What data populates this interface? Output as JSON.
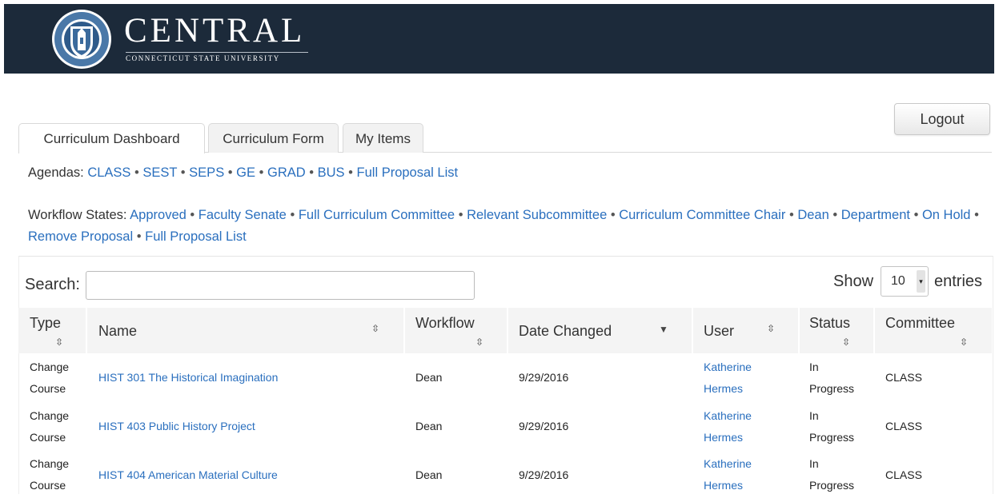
{
  "header": {
    "logo_word": "CENTRAL",
    "logo_subtitle": "CONNECTICUT STATE UNIVERSITY"
  },
  "logout_label": "Logout",
  "tabs": [
    {
      "label": "Curriculum Dashboard",
      "active": true
    },
    {
      "label": "Curriculum Form",
      "active": false
    },
    {
      "label": "My Items",
      "active": false
    }
  ],
  "agendas": {
    "prefix": "Agendas:",
    "links": [
      "CLASS",
      "SEST",
      "SEPS",
      "GE",
      "GRAD",
      "BUS",
      "Full Proposal List"
    ]
  },
  "workflow_states": {
    "prefix": "Workflow States:",
    "links": [
      "Approved",
      "Faculty Senate",
      "Full Curriculum Committee",
      "Relevant Subcommittee",
      "Curriculum Committee Chair",
      "Dean",
      "Department",
      "On Hold",
      "Remove Proposal",
      "Full Proposal List"
    ]
  },
  "search": {
    "label": "Search:",
    "value": ""
  },
  "length": {
    "show_label": "Show",
    "value": "10",
    "entries_label": "entries"
  },
  "table": {
    "columns": [
      "Type",
      "Name",
      "Workflow",
      "Date Changed",
      "User",
      "Status",
      "Committee"
    ],
    "rows": [
      {
        "type": [
          "Change",
          "Course"
        ],
        "name": "HIST 301 The Historical Imagination",
        "workflow": "Dean",
        "date": "9/29/2016",
        "user": [
          "Katherine",
          "Hermes"
        ],
        "status": [
          "In",
          "Progress"
        ],
        "committee": "CLASS"
      },
      {
        "type": [
          "Change",
          "Course"
        ],
        "name": "HIST 403 Public History Project",
        "workflow": "Dean",
        "date": "9/29/2016",
        "user": [
          "Katherine",
          "Hermes"
        ],
        "status": [
          "In",
          "Progress"
        ],
        "committee": "CLASS"
      },
      {
        "type": [
          "Change",
          "Course"
        ],
        "name": "HIST 404 American Material Culture",
        "workflow": "Dean",
        "date": "9/29/2016",
        "user": [
          "Katherine",
          "Hermes"
        ],
        "status": [
          "In",
          "Progress"
        ],
        "committee": "CLASS"
      }
    ]
  },
  "colors": {
    "header_bg": "#1c2a3a",
    "link": "#2a6fbe"
  }
}
